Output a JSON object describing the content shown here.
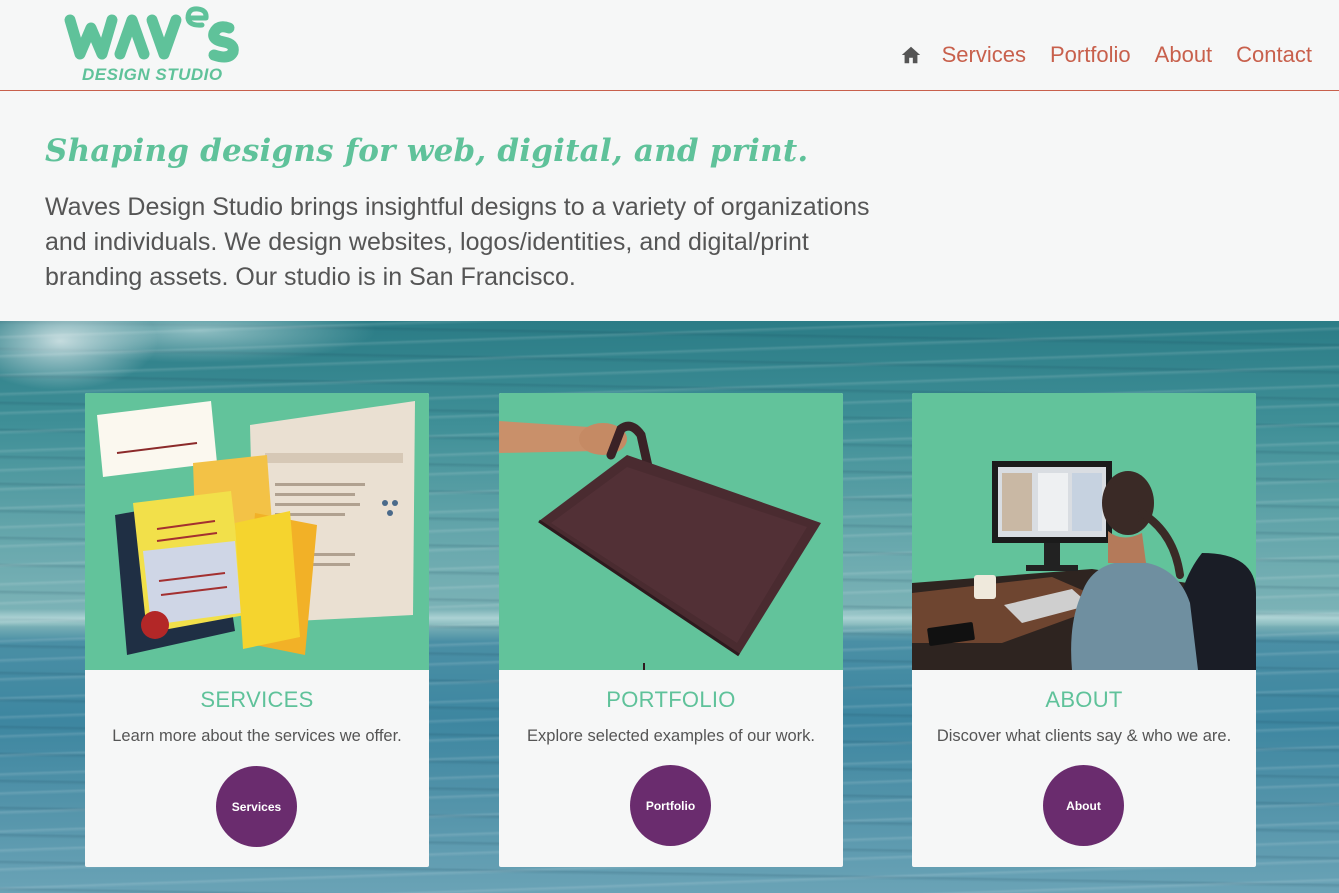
{
  "header": {
    "logo": {
      "wordmark": "WAVeS",
      "subtitle": "DESIGN STUDIO"
    },
    "nav": {
      "home_icon": "home-icon",
      "items": [
        "Services",
        "Portfolio",
        "About",
        "Contact"
      ]
    }
  },
  "intro": {
    "tagline": "Shaping designs for web, digital, and print.",
    "body": "Waves Design Studio brings insightful designs to a variety of organizations and individuals. We design websites, logos/identities, and digital/print branding assets. Our studio is in San Francisco."
  },
  "cards": [
    {
      "title": "SERVICES",
      "description": "Learn more about the services we offer.",
      "button": "Services",
      "image": "printed-samples-image"
    },
    {
      "title": "PORTFOLIO",
      "description": "Explore selected examples of our work.",
      "button": "Portfolio",
      "image": "portfolio-case-image"
    },
    {
      "title": "ABOUT",
      "description": "Discover what clients say & who we are.",
      "button": "About",
      "image": "designer-at-desk-image"
    }
  ],
  "colors": {
    "accent_green": "#5fc29a",
    "nav_coral": "#c8604c",
    "button_purple": "#6a2c6e",
    "card_image_bg": "#62c39b",
    "text_gray": "#555555"
  }
}
